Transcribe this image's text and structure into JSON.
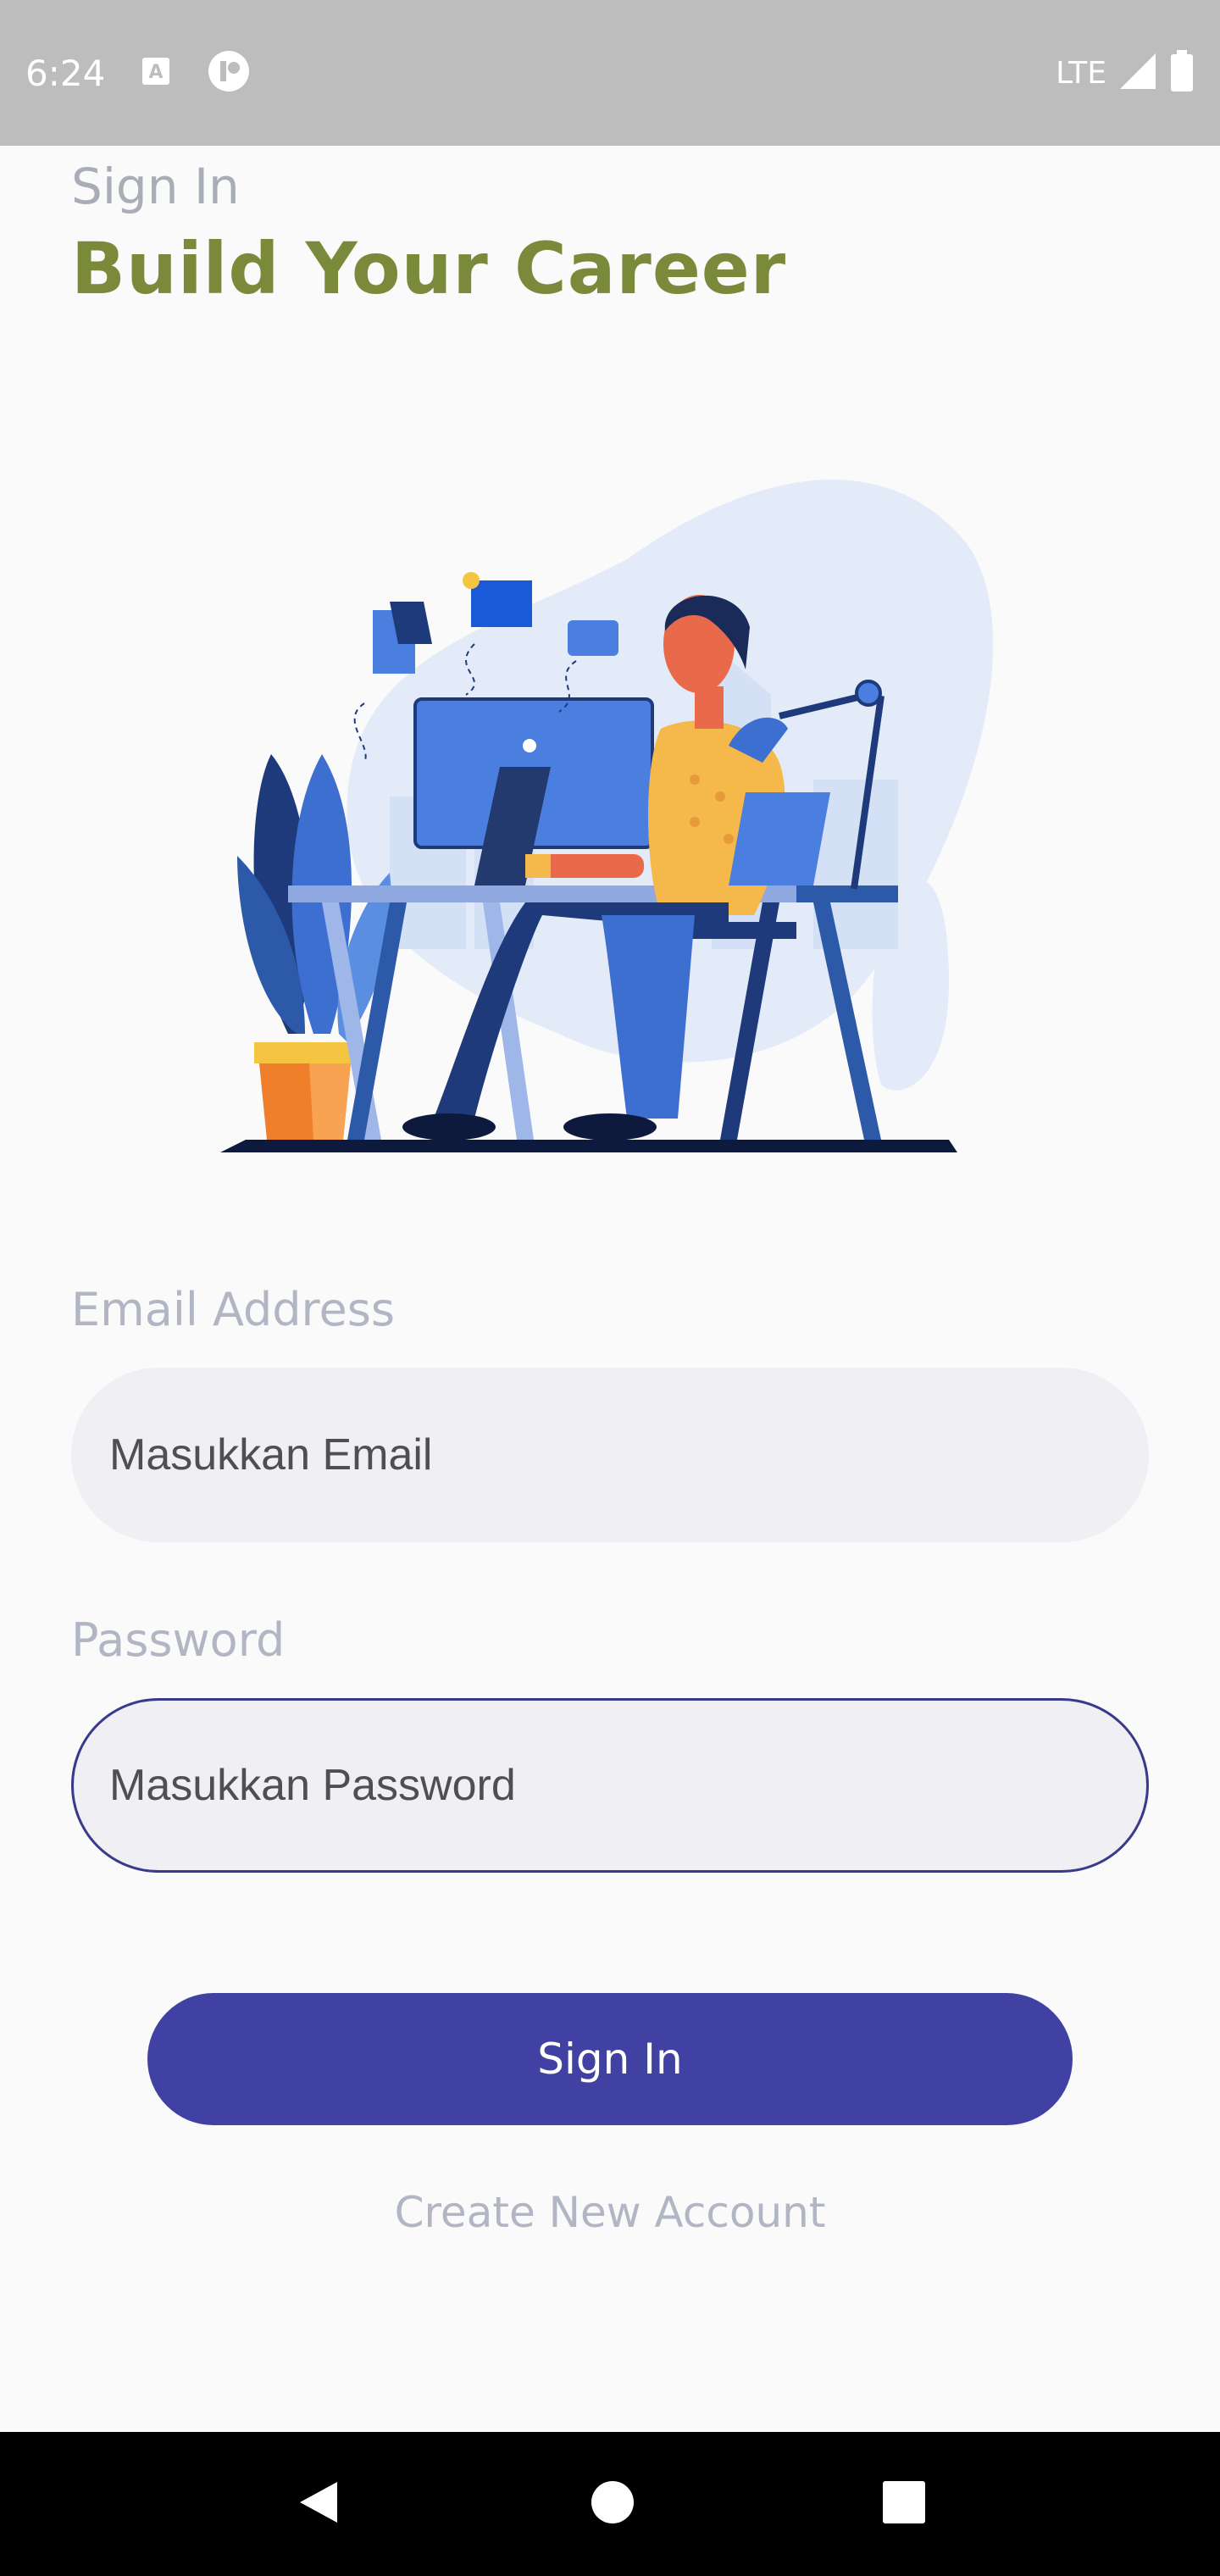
{
  "status_bar": {
    "time": "6:24",
    "network": "LTE",
    "icons": [
      "a-notification-icon",
      "app-notification-icon",
      "signal-icon",
      "battery-icon"
    ]
  },
  "header": {
    "subtitle": "Sign In",
    "title": "Build Your Career"
  },
  "illustration": {
    "description_icon": "person-working-at-desk-illustration"
  },
  "form": {
    "email_label": "Email Address",
    "email_placeholder": "Masukkan Email",
    "password_label": "Password",
    "password_placeholder": "Masukkan Password",
    "submit_label": "Sign In",
    "create_account_label": "Create New Account"
  },
  "colors": {
    "title": "#7b8a3a",
    "primary": "#4141a3",
    "label": "#b2b5c4",
    "input_bg": "#f0f0f4"
  },
  "nav_bar": {
    "icons": [
      "back-icon",
      "home-icon",
      "recents-icon"
    ]
  }
}
